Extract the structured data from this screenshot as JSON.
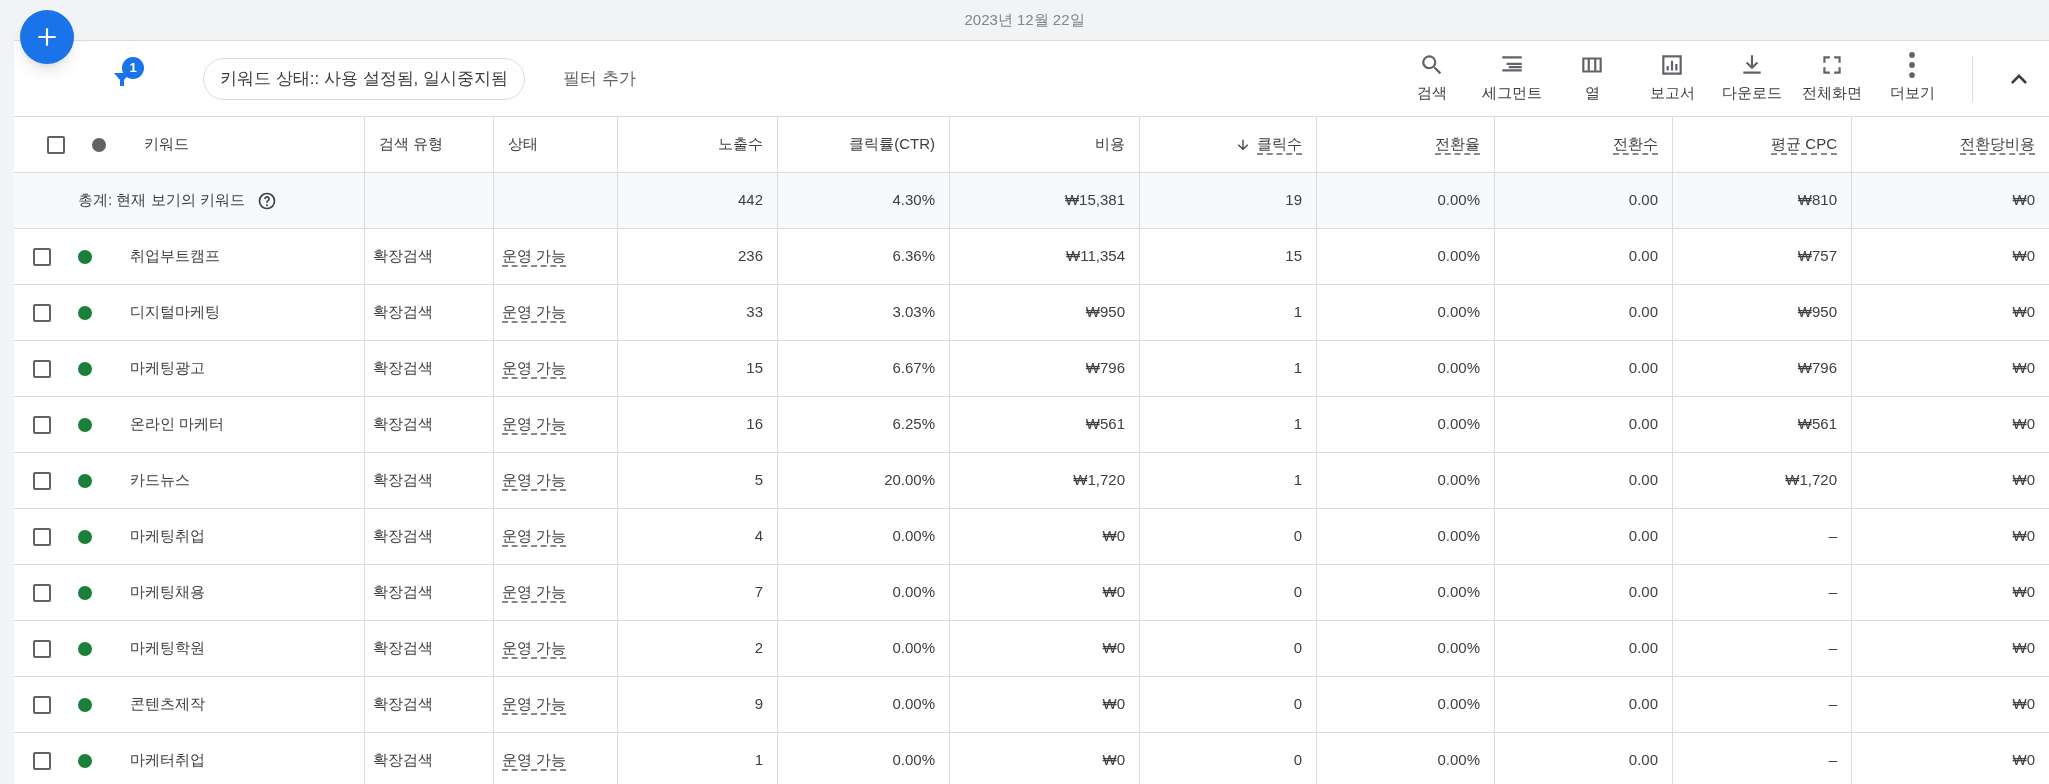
{
  "date": "2023년 12월 22일",
  "filter": {
    "count": "1",
    "chip": "키워드 상태:: 사용 설정됨, 일시중지됨",
    "add": "필터 추가"
  },
  "toolbar": [
    {
      "label": "검색"
    },
    {
      "label": "세그먼트"
    },
    {
      "label": "열"
    },
    {
      "label": "보고서"
    },
    {
      "label": "다운로드"
    },
    {
      "label": "전체화면"
    },
    {
      "label": "더보기"
    }
  ],
  "table": {
    "select_all_checked": false,
    "columns": [
      {
        "label": "키워드",
        "underlined": false,
        "sorted": false
      },
      {
        "label": "검색 유형",
        "underlined": false,
        "sorted": false
      },
      {
        "label": "상태",
        "underlined": false,
        "sorted": false
      },
      {
        "label": "노출수",
        "underlined": false,
        "sorted": false
      },
      {
        "label": "클릭률(CTR)",
        "underlined": false,
        "sorted": false
      },
      {
        "label": "비용",
        "underlined": false,
        "sorted": false
      },
      {
        "label": "클릭수",
        "underlined": true,
        "sorted": true
      },
      {
        "label": "전환율",
        "underlined": true,
        "sorted": false
      },
      {
        "label": "전환수",
        "underlined": true,
        "sorted": false
      },
      {
        "label": "평균 CPC",
        "underlined": true,
        "sorted": false
      },
      {
        "label": "전환당비용",
        "underlined": true,
        "sorted": false
      }
    ],
    "summary": {
      "label": "총계: 현재 보기의 키워드",
      "metrics": [
        "442",
        "4.30%",
        "₩15,381",
        "19",
        "0.00%",
        "0.00",
        "₩810",
        "₩0"
      ]
    },
    "rows": [
      {
        "checked": false,
        "color": "#188038",
        "keyword": "취업부트캠프",
        "match_type": "확장검색",
        "status": "운영 가능",
        "metrics": [
          "236",
          "6.36%",
          "₩11,354",
          "15",
          "0.00%",
          "0.00",
          "₩757",
          "₩0"
        ]
      },
      {
        "checked": false,
        "color": "#188038",
        "keyword": "디지털마케팅",
        "match_type": "확장검색",
        "status": "운영 가능",
        "metrics": [
          "33",
          "3.03%",
          "₩950",
          "1",
          "0.00%",
          "0.00",
          "₩950",
          "₩0"
        ]
      },
      {
        "checked": false,
        "color": "#188038",
        "keyword": "마케팅광고",
        "match_type": "확장검색",
        "status": "운영 가능",
        "metrics": [
          "15",
          "6.67%",
          "₩796",
          "1",
          "0.00%",
          "0.00",
          "₩796",
          "₩0"
        ]
      },
      {
        "checked": false,
        "color": "#188038",
        "keyword": "온라인 마케터",
        "match_type": "확장검색",
        "status": "운영 가능",
        "metrics": [
          "16",
          "6.25%",
          "₩561",
          "1",
          "0.00%",
          "0.00",
          "₩561",
          "₩0"
        ]
      },
      {
        "checked": false,
        "color": "#188038",
        "keyword": "카드뉴스",
        "match_type": "확장검색",
        "status": "운영 가능",
        "metrics": [
          "5",
          "20.00%",
          "₩1,720",
          "1",
          "0.00%",
          "0.00",
          "₩1,720",
          "₩0"
        ]
      },
      {
        "checked": false,
        "color": "#188038",
        "keyword": "마케팅취업",
        "match_type": "확장검색",
        "status": "운영 가능",
        "metrics": [
          "4",
          "0.00%",
          "₩0",
          "0",
          "0.00%",
          "0.00",
          "–",
          "₩0"
        ]
      },
      {
        "checked": false,
        "color": "#188038",
        "keyword": "마케팅채용",
        "match_type": "확장검색",
        "status": "운영 가능",
        "metrics": [
          "7",
          "0.00%",
          "₩0",
          "0",
          "0.00%",
          "0.00",
          "–",
          "₩0"
        ]
      },
      {
        "checked": false,
        "color": "#188038",
        "keyword": "마케팅학원",
        "match_type": "확장검색",
        "status": "운영 가능",
        "metrics": [
          "2",
          "0.00%",
          "₩0",
          "0",
          "0.00%",
          "0.00",
          "–",
          "₩0"
        ]
      },
      {
        "checked": false,
        "color": "#188038",
        "keyword": "콘텐츠제작",
        "match_type": "확장검색",
        "status": "운영 가능",
        "metrics": [
          "9",
          "0.00%",
          "₩0",
          "0",
          "0.00%",
          "0.00",
          "–",
          "₩0"
        ]
      },
      {
        "checked": false,
        "color": "#188038",
        "keyword": "마케터취업",
        "match_type": "확장검색",
        "status": "운영 가능",
        "metrics": [
          "1",
          "0.00%",
          "₩0",
          "0",
          "0.00%",
          "0.00",
          "–",
          "₩0"
        ]
      }
    ]
  }
}
